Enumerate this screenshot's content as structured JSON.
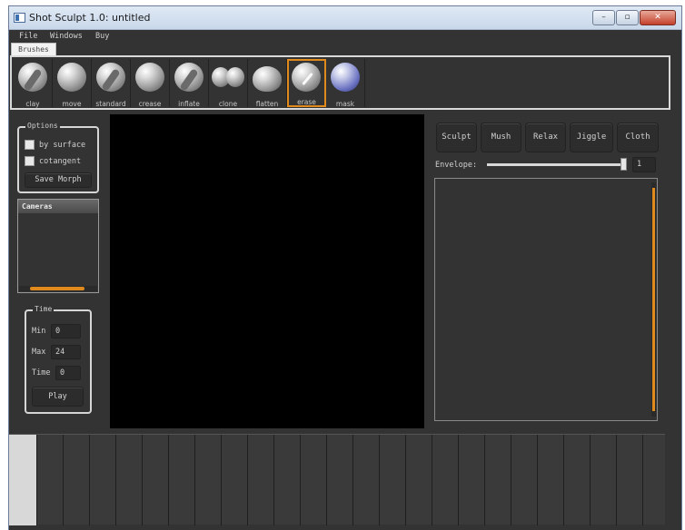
{
  "window": {
    "title": "Shot Sculpt 1.0: untitled",
    "buttons": {
      "minimize": "–",
      "maximize": "▫",
      "close": "✕"
    }
  },
  "menu": [
    "File",
    "Windows",
    "Buy"
  ],
  "tabs": {
    "brushes": "Brushes"
  },
  "brushes": [
    {
      "label": "clay",
      "selected": false
    },
    {
      "label": "move",
      "selected": false
    },
    {
      "label": "standard",
      "selected": false
    },
    {
      "label": "crease",
      "selected": false
    },
    {
      "label": "inflate",
      "selected": false
    },
    {
      "label": "clone",
      "selected": false
    },
    {
      "label": "flatten",
      "selected": false
    },
    {
      "label": "erase",
      "selected": true
    },
    {
      "label": "mask",
      "selected": false
    }
  ],
  "options": {
    "title": "Options",
    "by_surface": "by surface",
    "cotangent": "cotangent",
    "save_morph": "Save Morph"
  },
  "cameras": {
    "title": "Cameras"
  },
  "time": {
    "title": "Time",
    "min_label": "Min",
    "min_value": "0",
    "max_label": "Max",
    "max_value": "24",
    "time_label": "Time",
    "time_value": "0",
    "play": "Play"
  },
  "sim_buttons": [
    "Sculpt",
    "Mush",
    "Relax",
    "Jiggle",
    "Cloth"
  ],
  "envelope": {
    "label": "Envelope:",
    "value": "1",
    "level": 1.0
  },
  "colors": {
    "accent": "#e08a1e",
    "bg": "#333333",
    "viewport": "#000000"
  }
}
